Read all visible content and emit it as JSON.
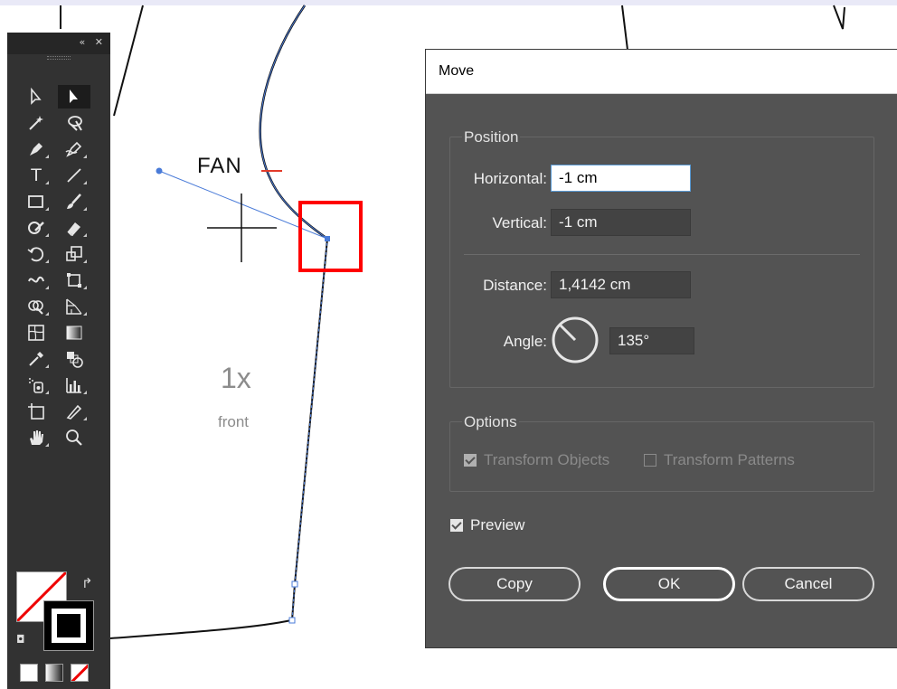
{
  "canvas": {
    "fan_label": "FAN",
    "count_label": "1x",
    "piece_label": "front"
  },
  "tools_panel": {
    "collapse_icon": "«",
    "close_icon": "✕",
    "tools": [
      {
        "name": "direct-selection-tool-icon"
      },
      {
        "name": "selection-tool-icon"
      },
      {
        "name": "magic-wand-tool-icon"
      },
      {
        "name": "lasso-tool-icon"
      },
      {
        "name": "pen-tool-icon"
      },
      {
        "name": "curvature-tool-icon"
      },
      {
        "name": "type-tool-icon",
        "glyph": "T"
      },
      {
        "name": "line-tool-icon"
      },
      {
        "name": "rectangle-tool-icon"
      },
      {
        "name": "paintbrush-tool-icon"
      },
      {
        "name": "shaper-tool-icon"
      },
      {
        "name": "eraser-tool-icon"
      },
      {
        "name": "rotate-tool-icon"
      },
      {
        "name": "scale-tool-icon"
      },
      {
        "name": "warp-tool-icon"
      },
      {
        "name": "free-transform-tool-icon"
      },
      {
        "name": "shape-builder-tool-icon"
      },
      {
        "name": "perspective-grid-tool-icon"
      },
      {
        "name": "mesh-tool-icon"
      },
      {
        "name": "gradient-tool-icon"
      },
      {
        "name": "eyedropper-tool-icon"
      },
      {
        "name": "blend-tool-icon"
      },
      {
        "name": "symbol-sprayer-tool-icon"
      },
      {
        "name": "column-graph-tool-icon"
      },
      {
        "name": "artboard-tool-icon"
      },
      {
        "name": "slice-tool-icon"
      },
      {
        "name": "hand-tool-icon"
      },
      {
        "name": "zoom-tool-icon"
      }
    ]
  },
  "dialog": {
    "title": "Move",
    "position_group": "Position",
    "horizontal_label": "Horizontal:",
    "horizontal_value": "-1 cm",
    "vertical_label": "Vertical:",
    "vertical_value": "-1 cm",
    "distance_label": "Distance:",
    "distance_value": "1,4142 cm",
    "angle_label": "Angle:",
    "angle_value": "135°",
    "options_group": "Options",
    "transform_objects_label": "Transform Objects",
    "transform_patterns_label": "Transform Patterns",
    "preview_label": "Preview",
    "copy_label": "Copy",
    "ok_label": "OK",
    "cancel_label": "Cancel"
  },
  "colors": {
    "selection_blue": "#4a7bd8",
    "highlight_red": "#ff0000",
    "dialog_bg": "#535353",
    "panel_bg": "#323232"
  }
}
